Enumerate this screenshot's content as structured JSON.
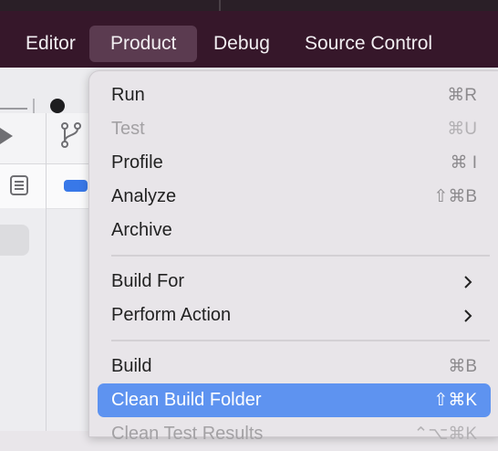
{
  "menubar": {
    "items": [
      {
        "label": "Editor"
      },
      {
        "label": "Product"
      },
      {
        "label": "Debug"
      },
      {
        "label": "Source Control"
      }
    ]
  },
  "product_menu": {
    "items": [
      {
        "label": "Run",
        "shortcut": "⌘R"
      },
      {
        "label": "Test",
        "shortcut": "⌘U",
        "enabled": false
      },
      {
        "label": "Profile",
        "shortcut": "⌘ I"
      },
      {
        "label": "Analyze",
        "shortcut": "⇧⌘B"
      },
      {
        "label": "Archive"
      },
      {
        "label": "Build For",
        "submenu": true
      },
      {
        "label": "Perform Action",
        "submenu": true
      },
      {
        "label": "Build",
        "shortcut": "⌘B"
      },
      {
        "label": "Clean Build Folder",
        "shortcut": "⇧⌘K",
        "highlighted": true
      },
      {
        "label": "Clean Test Results",
        "shortcut": "⌃⌥⌘K",
        "enabled": false
      }
    ]
  },
  "icons": {
    "play": "play-icon",
    "branch": "source-branch-icon",
    "list": "list-icon"
  },
  "colors": {
    "menubar_bg": "#36172a",
    "highlight": "#5e93f0",
    "accent_blue": "#3878e8"
  }
}
